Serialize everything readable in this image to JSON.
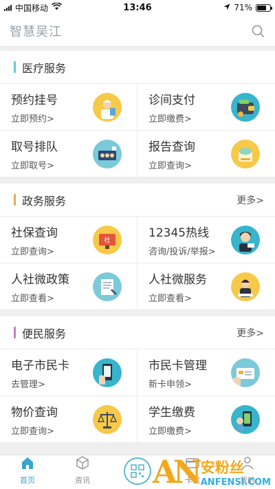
{
  "status_bar": {
    "carrier": "中国移动",
    "time": "13:46",
    "battery": "71%",
    "battery_level": 0.71
  },
  "header": {
    "title": "智慧吴江",
    "search_icon": "search-icon"
  },
  "sections": [
    {
      "title": "医疗服务",
      "bar_color": "#6cc3dc",
      "more": "",
      "items": [
        {
          "title": "预约挂号",
          "sub": "立即预约>",
          "icon": "nurse-icon",
          "bg": "#f7c948"
        },
        {
          "title": "诊间支付",
          "sub": "立即缴费>",
          "icon": "wallet-icon",
          "bg": "#38b4cc"
        },
        {
          "title": "取号排队",
          "sub": "立即取号>",
          "icon": "queue-icon",
          "bg": "#7cc9d9"
        },
        {
          "title": "报告查询",
          "sub": "立即查询>",
          "icon": "report-icon",
          "bg": "#f7c948"
        }
      ]
    },
    {
      "title": "政务服务",
      "bar_color": "#d8b061",
      "more": "更多>",
      "items": [
        {
          "title": "社保查询",
          "sub": "立即查询>",
          "icon": "social-security-icon",
          "bg": "#f7c948"
        },
        {
          "title": "12345热线",
          "sub": "咨询/投诉/举报>",
          "icon": "hotline-icon",
          "bg": "#38b4cc"
        },
        {
          "title": "人社微政策",
          "sub": "立即查看>",
          "icon": "policy-document-icon",
          "bg": "#7cc9d9"
        },
        {
          "title": "人社微服务",
          "sub": "立即查看>",
          "icon": "service-staff-icon",
          "bg": "#f7c948"
        }
      ]
    },
    {
      "title": "便民服务",
      "bar_color": "#c77fc2",
      "more": "更多>",
      "items": [
        {
          "title": "电子市民卡",
          "sub": "去管理>",
          "icon": "phone-card-icon",
          "bg": "#38b4cc"
        },
        {
          "title": "市民卡管理",
          "sub": "新卡申领>",
          "icon": "citizen-card-icon",
          "bg": "#7cc9d9"
        },
        {
          "title": "物价查询",
          "sub": "立即查询>",
          "icon": "balance-scale-icon",
          "bg": "#f7c948"
        },
        {
          "title": "学生缴费",
          "sub": "立即缴费>",
          "icon": "student-pay-icon",
          "bg": "#38b4cc"
        }
      ]
    }
  ],
  "tabs": [
    {
      "label": "首页",
      "icon": "home-icon",
      "active": true
    },
    {
      "label": "资讯",
      "icon": "cube-icon",
      "active": false
    },
    {
      "label": "",
      "icon": "qr-code-icon",
      "active": false
    },
    {
      "label": "卡包",
      "icon": "card-icon",
      "active": false
    },
    {
      "label": "我的",
      "icon": "user-icon",
      "active": false
    }
  ],
  "watermark": {
    "logo": "AN",
    "cn": "安粉丝",
    "en": "ANFENSI.COM"
  },
  "colors": {
    "accent": "#35a6cf",
    "watermark_orange": "#f2a81d",
    "watermark_blue": "#33aee0"
  }
}
